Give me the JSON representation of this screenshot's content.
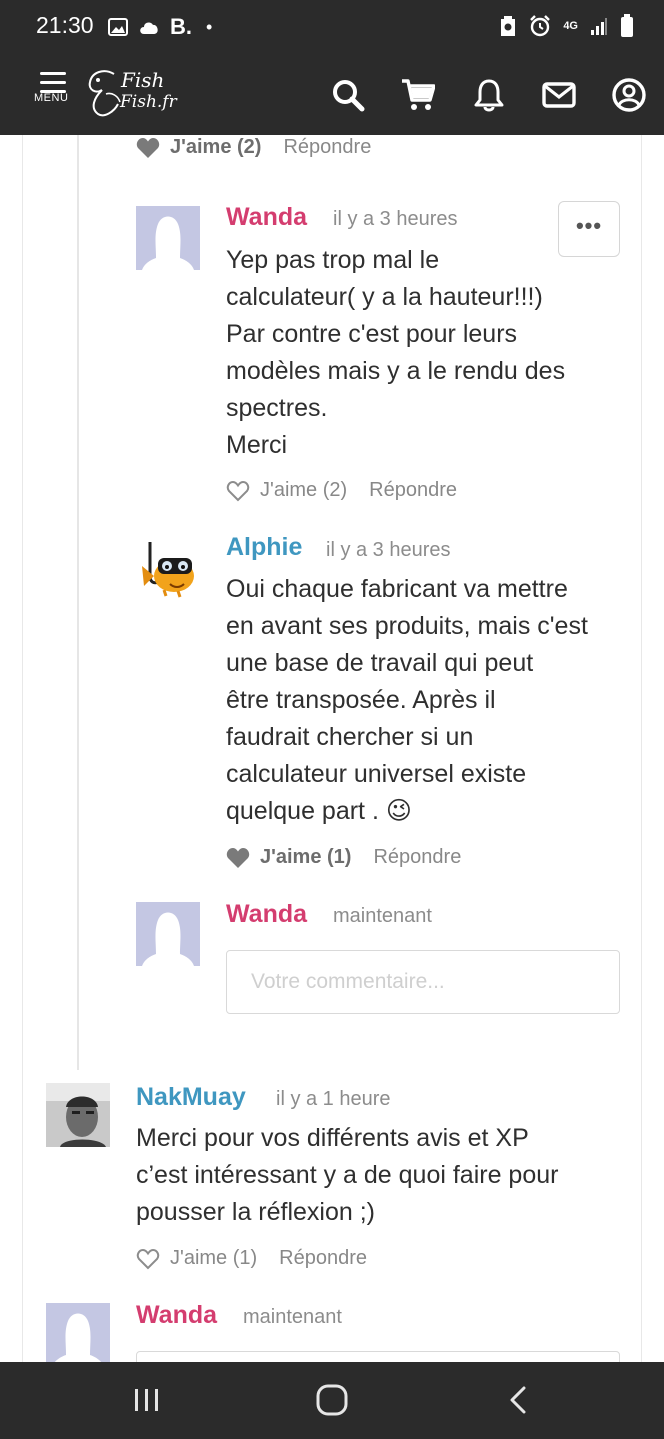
{
  "status_bar": {
    "time": "21:30",
    "notification_letter": "B.",
    "notification_dot": "•",
    "network_label": "4G",
    "icons": [
      "gallery-icon",
      "cloud-icon",
      "nfc-icon",
      "alarm-icon",
      "signal-icon",
      "battery-icon"
    ]
  },
  "header": {
    "menu_label": "MENU",
    "logo_line1": "Fish",
    "logo_line2": "Fish.fr",
    "icons": [
      "search-icon",
      "cart-icon",
      "bell-icon",
      "mail-icon",
      "account-icon"
    ]
  },
  "colors": {
    "header_bg": "#2b2b2b",
    "author_pink": "#d43d6f",
    "author_blue": "#3f97c0",
    "avatar_placeholder": "#c4c7e3"
  },
  "comments": {
    "top_actions": {
      "like_label": "J'aime (2)",
      "reply_label": "Répondre"
    },
    "wanda_1": {
      "author": "Wanda",
      "time": "il y a 3 heures",
      "more_label": "•••",
      "lines": [
        "Yep pas trop mal le",
        "calculateur( y a la hauteur!!!)",
        "Par contre c'est pour leurs",
        "modèles mais y a le rendu des",
        "spectres.",
        "Merci"
      ],
      "like_label": "J'aime (2)",
      "reply_label": "Répondre"
    },
    "alphie": {
      "author": "Alphie",
      "time": "il y a 3 heures",
      "lines": [
        "Oui chaque fabricant va mettre",
        "en avant ses produits, mais c'est",
        "une base de travail qui peut",
        "être transposée. Après il",
        "faudrait chercher si un",
        "calculateur universel existe",
        "quelque part . 😉"
      ],
      "like_label": "J'aime (1)",
      "reply_label": "Répondre"
    },
    "wanda_reply_1": {
      "author": "Wanda",
      "time": "maintenant",
      "placeholder": "Votre commentaire..."
    },
    "nakmuay": {
      "author": "NakMuay",
      "time": "il y a 1 heure",
      "lines": [
        "Merci pour vos différents avis et XP",
        "c’est intéressant y a de quoi faire pour",
        "pousser la réflexion ;)"
      ],
      "like_label": "J'aime (1)",
      "reply_label": "Répondre"
    },
    "wanda_reply_2": {
      "author": "Wanda",
      "time": "maintenant"
    }
  },
  "nav_bar": {
    "icons": [
      "recent-apps-icon",
      "home-icon",
      "back-icon"
    ]
  }
}
